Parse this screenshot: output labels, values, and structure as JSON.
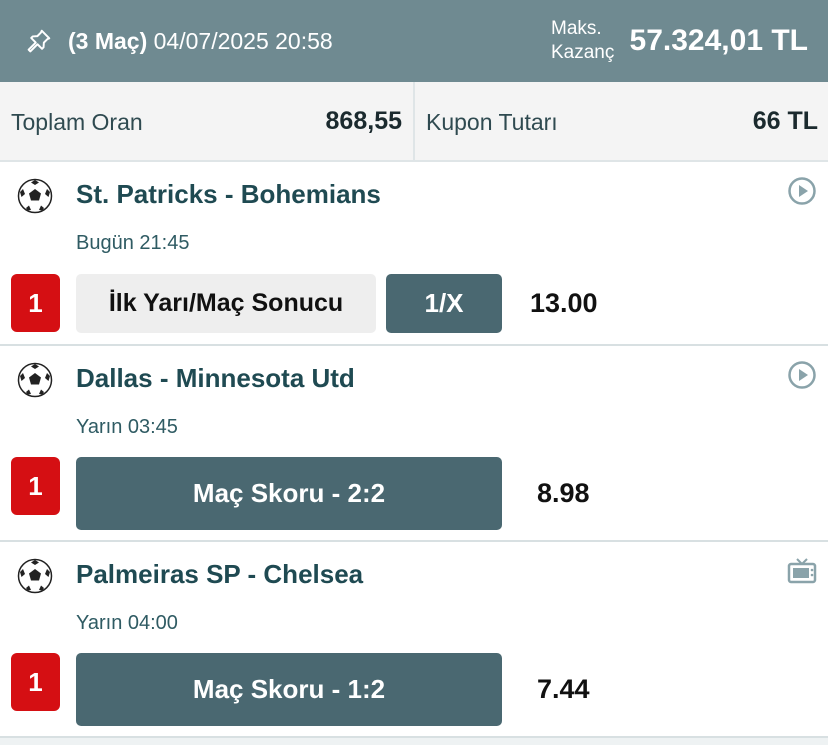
{
  "header": {
    "match_count": "(3 Maç)",
    "datetime": "04/07/2025 20:58",
    "max_win_label_line1": "Maks.",
    "max_win_label_line2": "Kazanç",
    "max_win_value": "57.324,01 TL",
    "pin_icon": "pin-icon"
  },
  "summary": {
    "total_odds_label": "Toplam Oran",
    "total_odds_value": "868,55",
    "coupon_amount_label": "Kupon Tutarı",
    "coupon_amount_value": "66 TL"
  },
  "matches": [
    {
      "teams": "St. Patricks - Bohemians",
      "time": "Bugün 21:45",
      "badge": "1",
      "market": "İlk Yarı/Maç Sonucu",
      "selection": "1/X",
      "odds": "13.00",
      "sport_icon": "soccer-ball-icon",
      "corner_icon": "play-circle-icon"
    },
    {
      "teams": "Dallas - Minnesota Utd",
      "time": "Yarın 03:45",
      "badge": "1",
      "selection": "Maç Skoru - 2:2",
      "odds": "8.98",
      "sport_icon": "soccer-ball-icon",
      "corner_icon": "play-circle-icon"
    },
    {
      "teams": "Palmeiras SP - Chelsea",
      "time": "Yarın 04:00",
      "badge": "1",
      "selection": "Maç Skoru - 1:2",
      "odds": "7.44",
      "sport_icon": "soccer-ball-icon",
      "corner_icon": "tv-icon"
    }
  ],
  "colors": {
    "header_bg": "#6f8a91",
    "badge_red": "#d50f13",
    "selection_dark": "#4a6871"
  }
}
